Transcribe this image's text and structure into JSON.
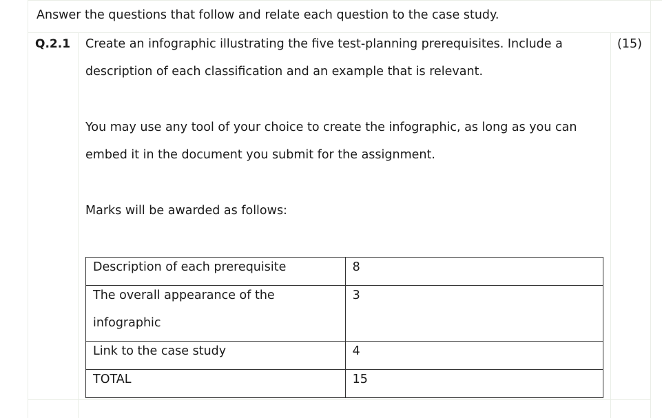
{
  "intro": "Answer the questions that follow and relate each question to the case study.",
  "question": {
    "number": "Q.2.1",
    "marks": "(15)",
    "para1_line1": "Create an infographic illustrating the five test-planning prerequisites. Include a",
    "para1_line2": "description of each classification and an example that is relevant.",
    "para2_line1": "You may use any tool of your choice to create the infographic, as long as you can",
    "para2_line2": "embed it in the document you submit for the assignment.",
    "para3": "Marks will be awarded as follows:"
  },
  "marks_table": {
    "rows": [
      {
        "label": "Description of each prerequisite",
        "value": "8"
      },
      {
        "label_line1": "The overall appearance of the",
        "label_line2": "infographic",
        "value": "3"
      },
      {
        "label": "Link to the case study",
        "value": "4"
      },
      {
        "label": "TOTAL",
        "value": "15"
      }
    ]
  }
}
